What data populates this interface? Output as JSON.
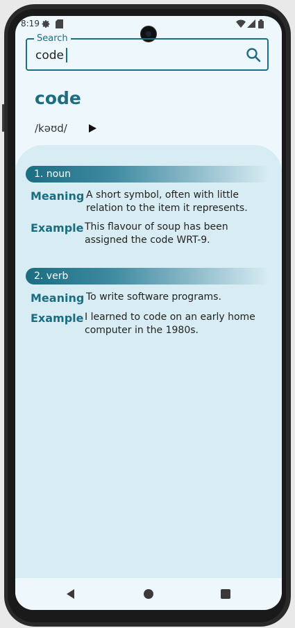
{
  "status": {
    "time": "8:19"
  },
  "search": {
    "label": "Search",
    "value": "code"
  },
  "entry": {
    "word": "code",
    "phonetic": "/kəʊd/",
    "senses": [
      {
        "pos": "1. noun",
        "meaning_label": "Meaning",
        "meaning": "A short symbol, often with little relation to the item it represents.",
        "example_label": "Example",
        "example": "This flavour of soup has been assigned the code WRT-9."
      },
      {
        "pos": "2. verb",
        "meaning_label": "Meaning",
        "meaning": "To write software programs.",
        "example_label": "Example",
        "example": "I learned to code on an early home computer in the 1980s."
      }
    ]
  },
  "colors": {
    "accent": "#1b6d82",
    "card": "#d8ecf3",
    "background": "#eef7fc"
  },
  "icons": {
    "status": [
      "gear-icon",
      "sd-card-icon",
      "wifi-icon",
      "signal-icon",
      "battery-icon"
    ],
    "search": "search-icon",
    "play": "play-icon",
    "nav": [
      "back-icon",
      "home-icon",
      "recents-icon"
    ]
  }
}
